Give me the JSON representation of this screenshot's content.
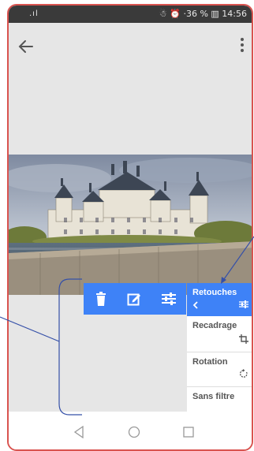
{
  "statusbar": {
    "left": ".ıl",
    "right": "☃ ⏰ ·36 % ▥ 14:56"
  },
  "header": {
    "back_icon": "arrow-left-icon",
    "menu_icon": "more-vertical-icon"
  },
  "photo": {
    "subject": "Château de Chambord"
  },
  "toolbar": {
    "icons": [
      "trash-icon",
      "edit-icon",
      "sliders-icon"
    ]
  },
  "menu": {
    "items": [
      {
        "label": "Retouches",
        "icon": "sliders-icon",
        "active": true
      },
      {
        "label": "Recadrage",
        "icon": "crop-icon",
        "active": false
      },
      {
        "label": "Rotation",
        "icon": "rotate-icon",
        "active": false
      },
      {
        "label": "Sans filtre",
        "icon": "",
        "active": false
      }
    ]
  },
  "colors": {
    "accent": "#3e82f7",
    "annotation": "#3550a8",
    "frame": "#d9534f"
  },
  "navbar": {
    "icons": [
      "back-triangle-icon",
      "home-circle-icon",
      "recents-square-icon"
    ]
  }
}
